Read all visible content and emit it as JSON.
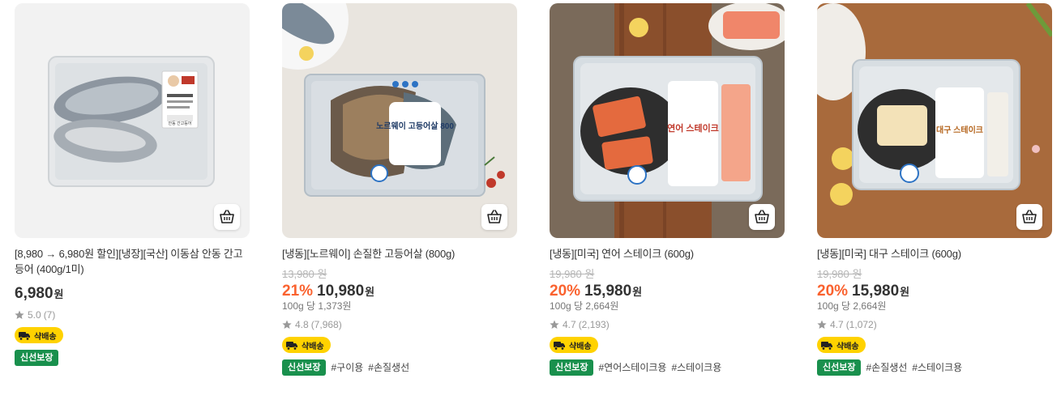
{
  "colors": {
    "discount": "#fa622f",
    "fresh_badge": "#19904d",
    "delivery_badge": "#ffd200"
  },
  "products": [
    {
      "name": "[8,980 → 6,980원 할인][냉장][국산] 이동삼 안동 간고등어 (400g/1미)",
      "original_price": "",
      "discount": "",
      "price": "6,980",
      "currency": "원",
      "unit_price": "",
      "rating": "5.0",
      "review_count": "(7)",
      "delivery_badge": "샥배송",
      "fresh_badge": "신선보장",
      "hashtags": [],
      "image_label": "안동 간고등어"
    },
    {
      "name": "[냉동][노르웨이] 손질한 고등어살 (800g)",
      "original_price": "13,980 원",
      "discount": "21%",
      "price": "10,980",
      "currency": "원",
      "unit_price": "100g 당 1,373원",
      "rating": "4.8",
      "review_count": "(7,968)",
      "delivery_badge": "샥배송",
      "fresh_badge": "신선보장",
      "hashtags": [
        "#구이용",
        "#손질생선"
      ],
      "image_label": "노르웨이 고등어살 800"
    },
    {
      "name": "[냉동][미국] 연어 스테이크 (600g)",
      "original_price": "19,980 원",
      "discount": "20%",
      "price": "15,980",
      "currency": "원",
      "unit_price": "100g 당 2,664원",
      "rating": "4.7",
      "review_count": "(2,193)",
      "delivery_badge": "샥배송",
      "fresh_badge": "신선보장",
      "hashtags": [
        "#연어스테이크용",
        "#스테이크용"
      ],
      "image_label": "연어 스테이크"
    },
    {
      "name": "[냉동][미국] 대구 스테이크 (600g)",
      "original_price": "19,980 원",
      "discount": "20%",
      "price": "15,980",
      "currency": "원",
      "unit_price": "100g 당 2,664원",
      "rating": "4.7",
      "review_count": "(1,072)",
      "delivery_badge": "샥배송",
      "fresh_badge": "신선보장",
      "hashtags": [
        "#손질생선",
        "#스테이크용"
      ],
      "image_label": "대구 스테이크"
    }
  ]
}
